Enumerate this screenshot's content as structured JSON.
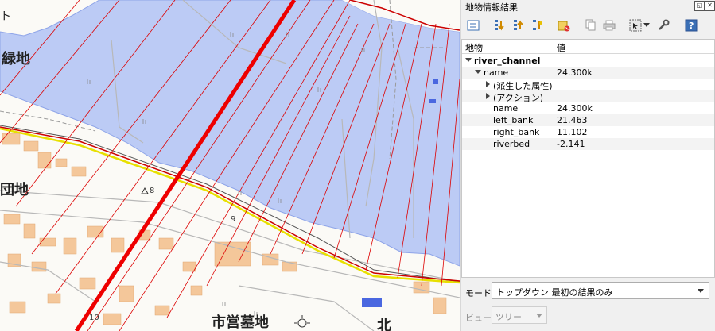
{
  "map": {
    "labels": {
      "green_area": "緑地",
      "park": "団地",
      "cemetery": "市営墓地",
      "north": "北",
      "num_8": "8",
      "num_9": "9",
      "num_10": "10",
      "left_char": "ト"
    }
  },
  "panel": {
    "title": "地物情報結果",
    "float_button": "◱",
    "close_button": "✕",
    "toolbar_icons": [
      "expand-tree-icon",
      "expand-all-icon",
      "collapse-all-icon",
      "expand-new-icon",
      "clear-results-icon",
      "copy-icon",
      "print-icon",
      "select-features-icon",
      "dropdown-arrow-icon",
      "settings-icon",
      "help-icon"
    ],
    "tree": {
      "columns": {
        "feature": "地物",
        "value": "値"
      },
      "layer": "river_channel",
      "feature_name_key": "name",
      "feature_name_value": "24.300k",
      "derived": "(派生した属性)",
      "actions": "(アクション)",
      "attributes": [
        {
          "key": "name",
          "value": "24.300k"
        },
        {
          "key": "left_bank",
          "value": "21.463"
        },
        {
          "key": "right_bank",
          "value": "11.102"
        },
        {
          "key": "riverbed",
          "value": "-2.141"
        }
      ]
    },
    "mode": {
      "label": "モード",
      "value": "トップダウン 最初の結果のみ"
    },
    "view": {
      "label": "ビュー",
      "value": "ツリー"
    }
  }
}
